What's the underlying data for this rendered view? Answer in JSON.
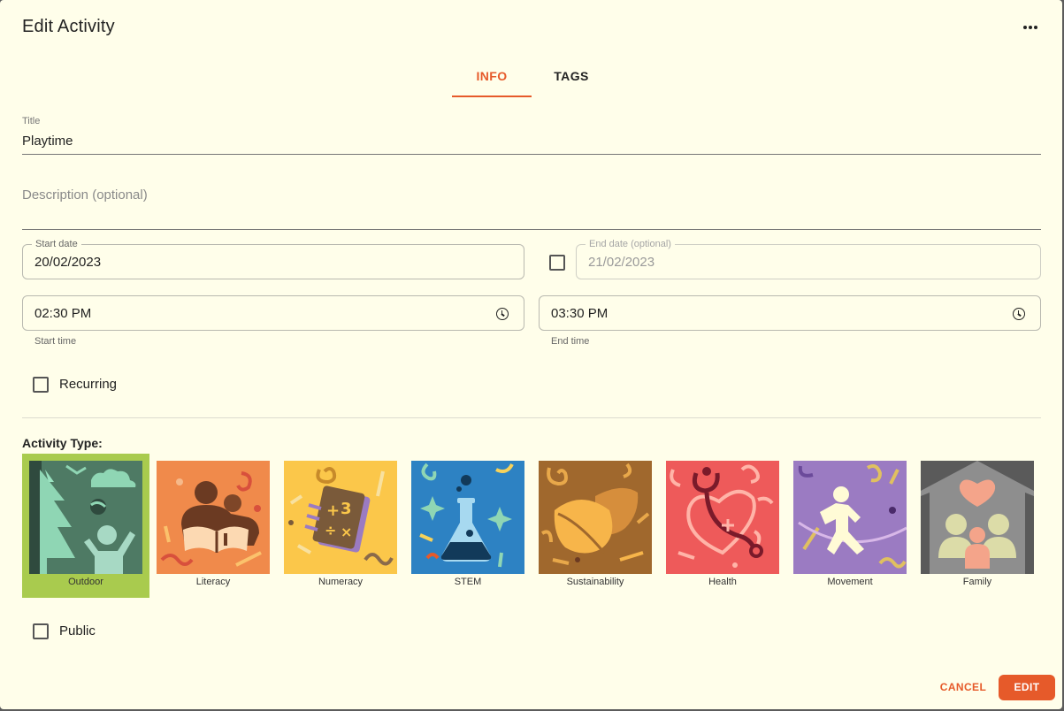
{
  "dialog": {
    "title": "Edit Activity",
    "menu_icon": "more-horizontal-icon"
  },
  "tabs": [
    {
      "label": "INFO",
      "active": true
    },
    {
      "label": "TAGS",
      "active": false
    }
  ],
  "form": {
    "title_label": "Title",
    "title_value": "Playtime",
    "description_placeholder": "Description (optional)",
    "start_date_label": "Start date",
    "start_date_value": "20/02/2023",
    "end_date_label": "End date (optional)",
    "end_date_value": "21/02/2023",
    "end_date_enabled": false,
    "start_time_value": "02:30 PM",
    "start_time_helper": "Start time",
    "end_time_value": "03:30 PM",
    "end_time_helper": "End time",
    "recurring_label": "Recurring",
    "recurring_checked": false,
    "public_label": "Public",
    "public_checked": false
  },
  "activity_type": {
    "heading": "Activity Type:",
    "selected": "Outdoor",
    "options": [
      {
        "label": "Outdoor",
        "color": "#4e7a64"
      },
      {
        "label": "Literacy",
        "color": "#f08a4b"
      },
      {
        "label": "Numeracy",
        "color": "#fbc74a"
      },
      {
        "label": "STEM",
        "color": "#2d82c3"
      },
      {
        "label": "Sustainability",
        "color": "#a0682d"
      },
      {
        "label": "Health",
        "color": "#ee5a5a"
      },
      {
        "label": "Movement",
        "color": "#9b7bc2"
      },
      {
        "label": "Family",
        "color": "#5a5a5a"
      }
    ]
  },
  "actions": {
    "cancel_label": "CANCEL",
    "edit_label": "EDIT"
  },
  "colors": {
    "accent": "#e65a2a",
    "background": "#fffeea",
    "selected_outline": "#a9cb4e"
  }
}
